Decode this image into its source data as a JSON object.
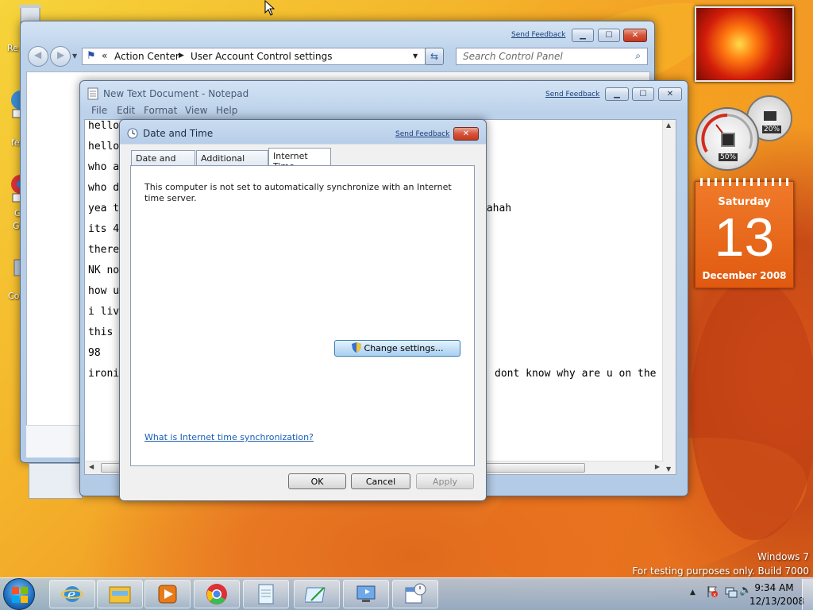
{
  "desktop": {
    "icon_labels": [
      "Re",
      "fe",
      "G",
      "G",
      "Co"
    ]
  },
  "control_panel": {
    "breadcrumb": [
      "Action Center",
      "User Account Control settings"
    ],
    "breadcrumb_sep": "»",
    "search_placeholder": "Search Control Panel",
    "send_feedback": "Send Feedback"
  },
  "notepad": {
    "title": "New Text Document - Notepad",
    "send_feedback": "Send Feedback",
    "menu": [
      "File",
      "Edit",
      "Format",
      "View",
      "Help"
    ],
    "lines": [
      "hello",
      "hello",
      "who a",
      "who d",
      "yea t",
      "its 4",
      "there",
      "NK no",
      "how u",
      "i liv",
      "this",
      "98",
      "ironi"
    ],
    "right_fragments": [
      "hahah",
      "dont know why are u on the"
    ]
  },
  "dialog": {
    "title": "Date and Time",
    "send_feedback": "Send Feedback",
    "tabs": [
      "Date and Time",
      "Additional Clocks",
      "Internet Time"
    ],
    "active_tab": "Internet Time",
    "message": "This computer is not set to automatically synchronize with an Internet time server.",
    "change_button": "Change settings...",
    "help_link": "What is Internet time synchronization?",
    "ok": "OK",
    "cancel": "Cancel",
    "apply": "Apply"
  },
  "gadgets": {
    "cpu_percent": "50%",
    "memory_percent": "20%",
    "calendar": {
      "weekday": "Saturday",
      "day": "13",
      "month_year": "December 2008"
    }
  },
  "watermark": {
    "line1": "Windows 7",
    "line2": "For testing purposes only. Build 7000"
  },
  "taskbar": {
    "time": "9:34 AM",
    "date": "12/13/2008",
    "apps": [
      "internet-explorer",
      "windows-explorer",
      "media-player",
      "chrome",
      "notepad",
      "paint",
      "remote-desktop",
      "calendar-clock"
    ]
  },
  "colors": {
    "accent": "#1a3f7a",
    "calendar_orange": "#e05a10",
    "dialog_button_blue": "#bcd7f0"
  }
}
